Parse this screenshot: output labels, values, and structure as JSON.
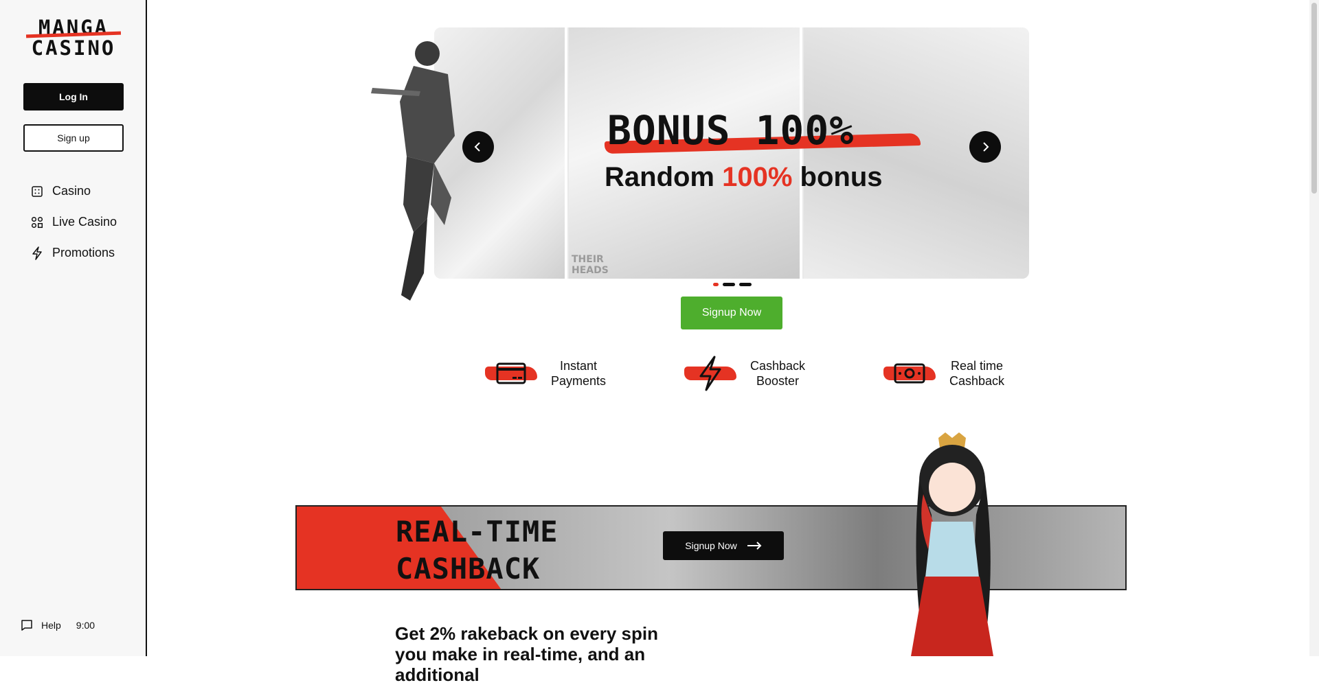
{
  "sidebar": {
    "logo_line1": "MANGA",
    "logo_line2": "CASINO",
    "login_label": "Log In",
    "signup_label": "Sign up",
    "nav": [
      {
        "label": "Casino",
        "icon": "casino-icon"
      },
      {
        "label": "Live Casino",
        "icon": "live-casino-icon"
      },
      {
        "label": "Promotions",
        "icon": "lightning-icon"
      }
    ],
    "help_label": "Help",
    "time": "9:00"
  },
  "hero": {
    "title": "BONUS 100%",
    "subtitle_pre": "Random ",
    "subtitle_highlight": "100%",
    "subtitle_post": " bonus",
    "panel_text_1": "THEIR",
    "panel_text_2": "HEADS",
    "slides": 3,
    "active_slide": 1,
    "accent_color": "#e53323"
  },
  "cta": {
    "signup_now": "Signup Now",
    "color": "#4eae2d"
  },
  "features": [
    {
      "line1": "Instant",
      "line2": "Payments",
      "icon": "credit-card-icon"
    },
    {
      "line1": "Cashback",
      "line2": "Booster",
      "icon": "lightning-bolt-icon"
    },
    {
      "line1": "Real time",
      "line2": "Cashback",
      "icon": "banknote-icon"
    }
  ],
  "banner": {
    "title_line1": "REAL-TIME",
    "title_line2": "CASHBACK",
    "button_label": "Signup Now"
  },
  "promo": {
    "text": "Get 2% rakeback on every spin you make in real-time, and an additional"
  }
}
